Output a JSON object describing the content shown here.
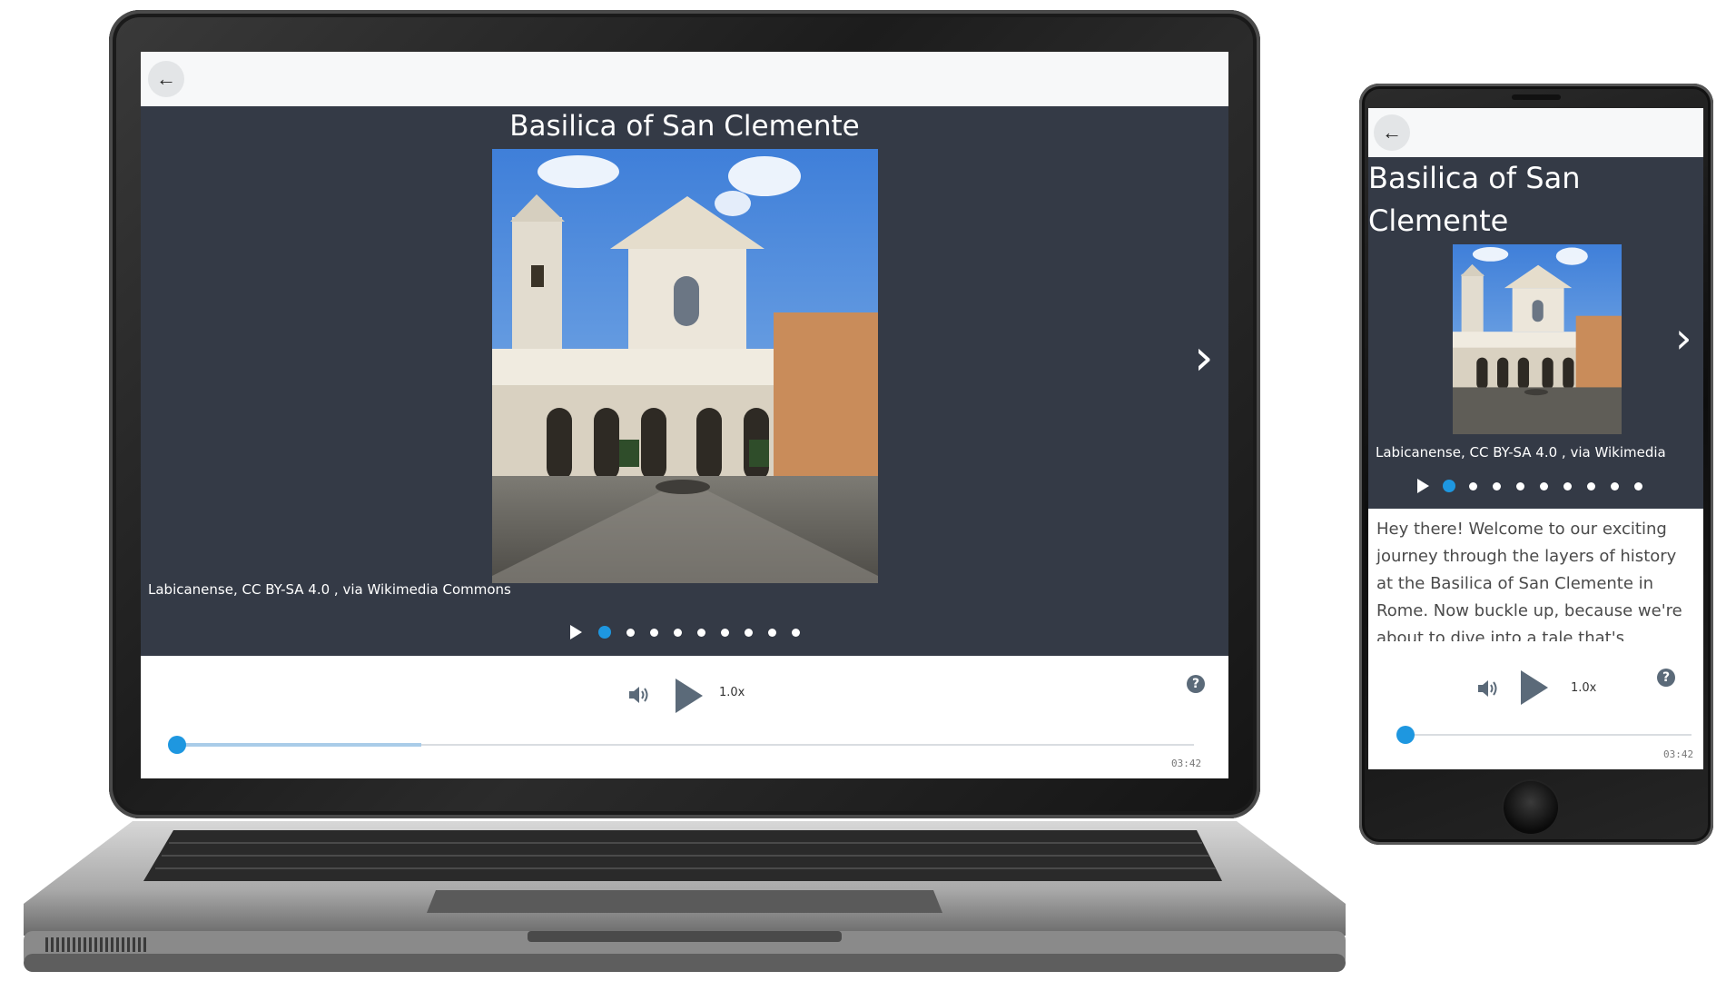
{
  "app": {
    "title": "Basilica of San Clemente",
    "image_caption_laptop": "Labicanense, CC BY-SA 4.0 , via Wikimedia Commons",
    "image_caption_phone": "Labicanense, CC BY-SA 4.0 , via Wikimedia",
    "slide_count": 9,
    "active_slide": 1,
    "speed_label": "1.0x",
    "duration": "03:42",
    "playback_progress": 0,
    "buffered_fraction": 0.24,
    "transcript_text": "Hey there! Welcome to our exciting journey through the layers of history at the Basilica of San Clemente in Rome. Now buckle up, because we're about to dive into a tale that's",
    "icons": {
      "back": "arrow-left-icon",
      "next": "chevron-right-icon",
      "play": "play-icon",
      "volume": "volume-icon",
      "help": "help-icon"
    },
    "help_glyph": "?",
    "back_glyph": "←",
    "next_glyph": "›",
    "colors": {
      "slide_bg": "#343a46",
      "accent": "#1e97e0",
      "topbar": "#f7f8f9",
      "control": "#5b6a79"
    }
  }
}
